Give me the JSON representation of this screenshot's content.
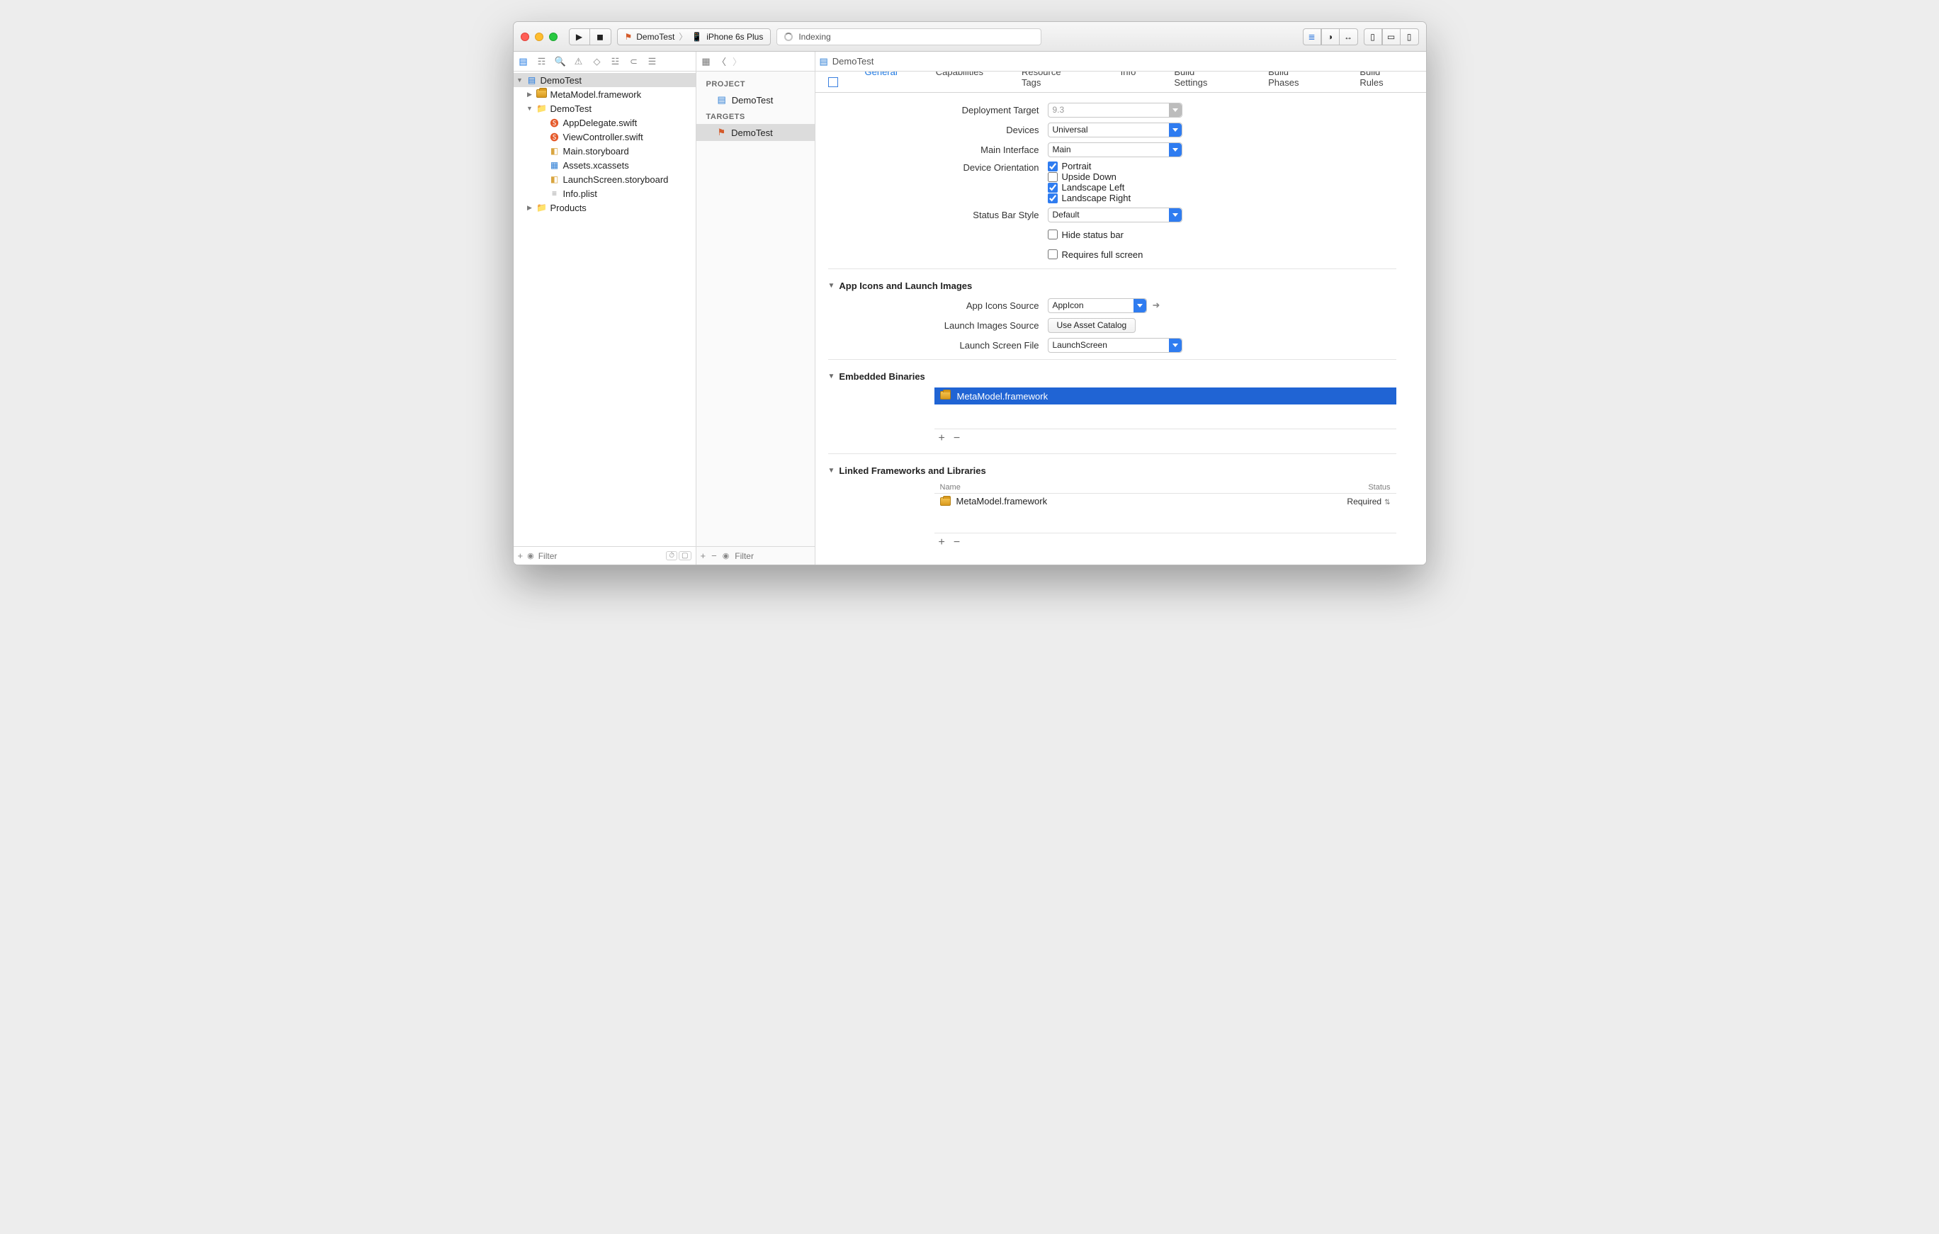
{
  "toolbar": {
    "scheme_project": "DemoTest",
    "scheme_device": "iPhone 6s Plus",
    "activity_text": "Indexing"
  },
  "navbar": {
    "breadcrumb_file": "DemoTest"
  },
  "sidebar": {
    "root": "DemoTest",
    "items": [
      "MetaModel.framework",
      "DemoTest",
      "AppDelegate.swift",
      "ViewController.swift",
      "Main.storyboard",
      "Assets.xcassets",
      "LaunchScreen.storyboard",
      "Info.plist",
      "Products"
    ],
    "filter_placeholder": "Filter"
  },
  "targets": {
    "project_header": "PROJECT",
    "project_item": "DemoTest",
    "targets_header": "TARGETS",
    "target_item": "DemoTest",
    "filter_placeholder": "Filter"
  },
  "tabs": {
    "general": "General",
    "capabilities": "Capabilities",
    "resource_tags": "Resource Tags",
    "info": "Info",
    "build_settings": "Build Settings",
    "build_phases": "Build Phases",
    "build_rules": "Build Rules"
  },
  "form": {
    "deployment_target_label": "Deployment Target",
    "deployment_target_value": "9.3",
    "devices_label": "Devices",
    "devices_value": "Universal",
    "main_interface_label": "Main Interface",
    "main_interface_value": "Main",
    "device_orientation_label": "Device Orientation",
    "orientations": {
      "portrait": "Portrait",
      "upside_down": "Upside Down",
      "landscape_left": "Landscape Left",
      "landscape_right": "Landscape Right"
    },
    "status_bar_label": "Status Bar Style",
    "status_bar_value": "Default",
    "hide_status_bar": "Hide status bar",
    "requires_full_screen": "Requires full screen",
    "app_icons_section": "App Icons and Launch Images",
    "app_icons_source_label": "App Icons Source",
    "app_icons_source_value": "AppIcon",
    "launch_images_source_label": "Launch Images Source",
    "use_asset_catalog": "Use Asset Catalog",
    "launch_screen_file_label": "Launch Screen File",
    "launch_screen_file_value": "LaunchScreen",
    "embedded_section": "Embedded Binaries",
    "embedded_item": "MetaModel.framework",
    "linked_section": "Linked Frameworks and Libraries",
    "linked_name_hdr": "Name",
    "linked_status_hdr": "Status",
    "linked_item": "MetaModel.framework",
    "linked_status_value": "Required"
  }
}
